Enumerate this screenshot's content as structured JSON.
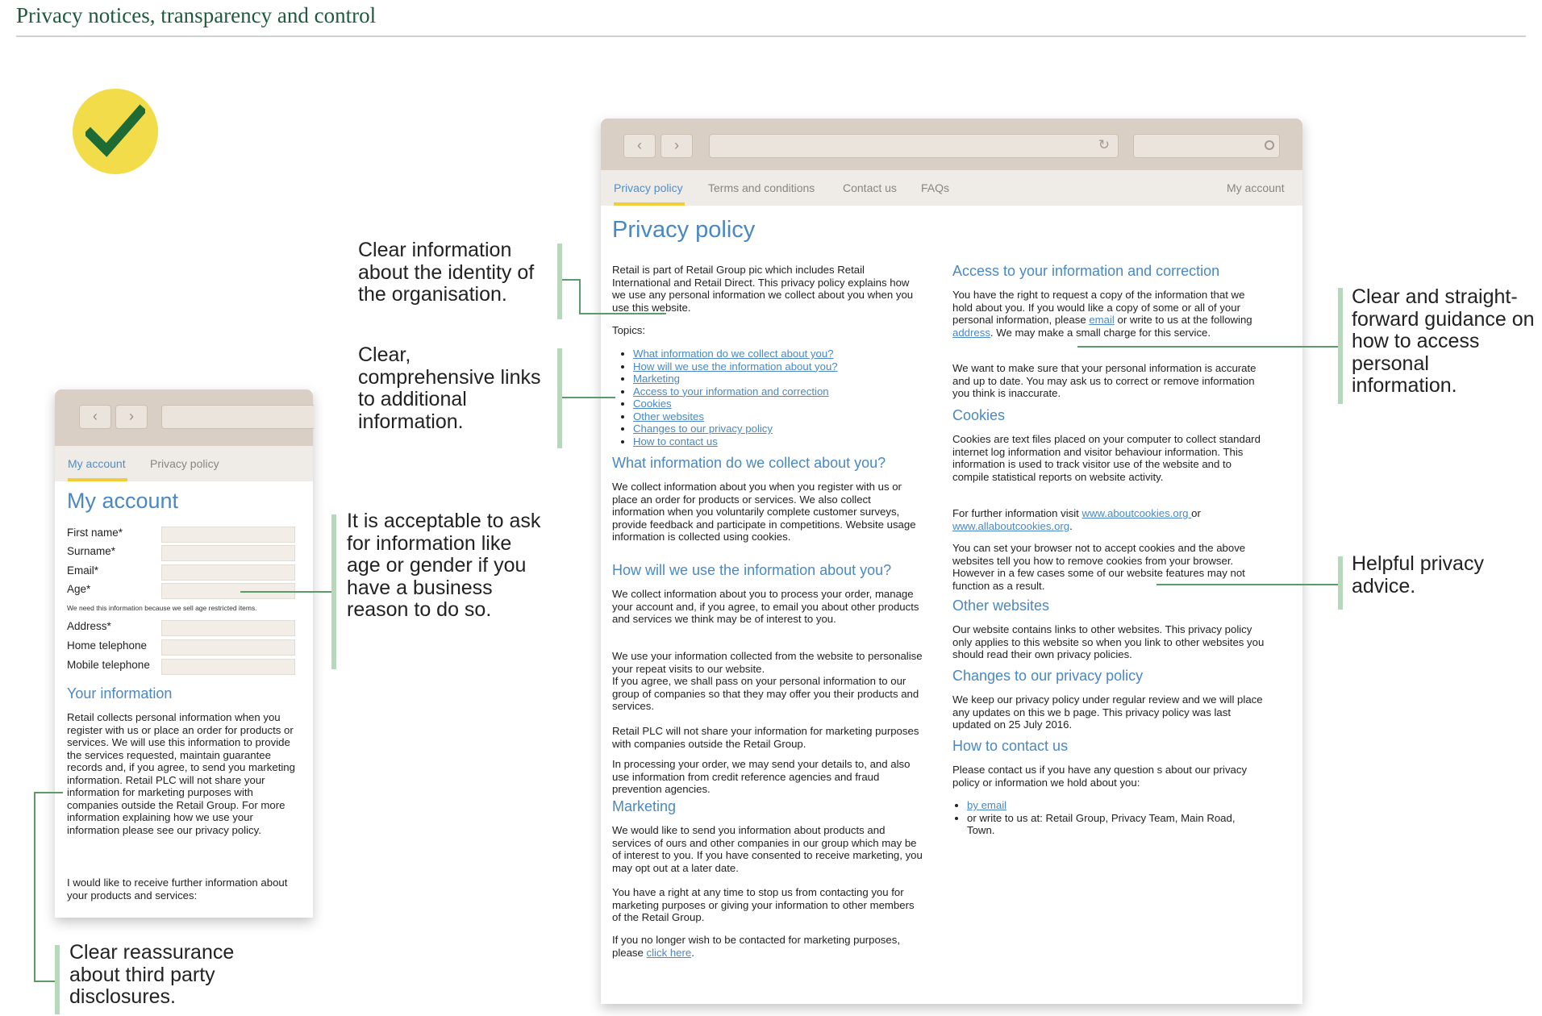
{
  "page_title": "Privacy notices, transparency and control",
  "icons": {
    "check": "checkmark-icon",
    "back": "chevron-left-icon",
    "forward": "chevron-right-icon",
    "reload": "reload-icon",
    "search": "search-icon"
  },
  "colors": {
    "accent_blue": "#4a88c4",
    "title_green": "#1f5a3f",
    "badge_yellow": "#f3dc4a",
    "check_green": "#1e6b34",
    "tab_underline": "#f1cd3a",
    "callout_bar": "#b6d9bc"
  },
  "mobile": {
    "tabs": {
      "active": "My account",
      "other": "Privacy policy"
    },
    "heading": "My account",
    "fields": {
      "first_name": "First name*",
      "surname": "Surname*",
      "email": "Email*",
      "age": "Age*",
      "address": "Address*",
      "home_telephone": "Home telephone",
      "mobile_telephone": "Mobile telephone"
    },
    "age_note": "We need this information because we sell age restricted items.",
    "your_info_heading": "Your information",
    "your_info_text": "Retail collects personal information when you register with us or place an order for products or services. We will use this information to provide the services requested, maintain guarantee records and, if you agree, to send you marketing information. Retail PLC will not share your information for marketing purposes with companies outside the Retail Group. For more information explaining how we use your information please see our privacy policy.",
    "further_info_text": "I would like to receive further information about your products and services:"
  },
  "desktop": {
    "tabs": {
      "privacy": "Privacy policy",
      "terms": "Terms and conditions",
      "contact": "Contact us",
      "faqs": "FAQs",
      "account": "My account"
    },
    "heading": "Privacy policy",
    "intro": "Retail is part of Retail Group pic which includes Retail International and Retail Direct. This privacy policy explains how we use any personal information we collect about you when you use this website.",
    "topics_label": "Topics:",
    "topics": {
      "t1": "What information do we collect about you?",
      "t2": "How will we use the information about you?",
      "t3": "Marketing",
      "t4": "Access to your information and correction",
      "t5": "Cookies",
      "t6": "Other websites",
      "t7": "Changes to our privacy policy",
      "t8": "How to contact us"
    },
    "collect": {
      "heading": "What information do we collect about you?",
      "text": "We collect information about you when you register with us or place an order for products or services. We also collect information when you voluntarily complete customer surveys, provide feedback and participate in competitions. Website usage information is collected using cookies."
    },
    "use": {
      "heading": "How will we use the information about you?",
      "p1": "We collect information about you to process your order, manage your account and, if you agree, to email you about other products and services we think may be of interest to you.",
      "p2a": "We use your information collected from the website to personalise your repeat visits to our website.",
      "p2b": "If you agree, we shall pass on your personal information to our group of companies so that they may offer you their products and services.",
      "p3": "Retail PLC will not share your information for marketing purposes with companies outside the Retail Group.",
      "p4": "In processing your order, we may send your details to, and also use information from credit reference agencies and fraud prevention agencies."
    },
    "marketing": {
      "heading": "Marketing",
      "p1": "We would like to send you information about products and services of ours and other companies in our group which may be of interest to you. If you have consented to receive marketing, you may opt out at a later date.",
      "p2": "You have a right at any time to stop us from contacting you for marketing purposes or giving your information to other members of the Retail Group.",
      "p3_pre": "If you no longer wish to be contacted for marketing purposes, please ",
      "p3_link": "click here",
      "p3_post": "."
    },
    "access": {
      "heading": "Access to your information and correction",
      "p1_a": "You have the right to request a copy of the information that we hold about you. If you would like a copy of some or all of your personal information, please ",
      "p1_link1": "email",
      "p1_b": " or write to us at the following ",
      "p1_link2": "address",
      "p1_c": ". We may make a small charge for this service.",
      "p2": "We want to make sure that your personal information is accurate and up to date. You may ask us to correct or remove information you think is inaccurate."
    },
    "cookies": {
      "heading": "Cookies",
      "p1": "Cookies are text files placed on your computer to collect standard internet log information and visitor behaviour information. This information is used to track visitor use of the website and to compile statistical reports on website activity.",
      "p2_pre": "For further information visit ",
      "p2_link1": "www.aboutcookies.org ",
      "p2_mid": "or ",
      "p2_link2": "www.allaboutcookies.org",
      "p2_post": ".",
      "p3": "You can set your browser not to accept cookies and the above websites tell you how to remove cookies from your browser. However in a few cases some of our website features may not function as a result."
    },
    "other": {
      "heading": "Other websites",
      "text": "Our website contains links to other websites. This privacy policy only applies to this website so when you link to other websites you should read their own privacy policies."
    },
    "changes": {
      "heading": "Changes to our privacy policy",
      "text": "We keep our privacy policy under regular review and we will place any updates on this we b page. This privacy policy was last updated on 25 July 2016."
    },
    "contact": {
      "heading": "How to contact us",
      "text": "Please contact us if you have any question s about our privacy policy or information we hold about you:",
      "item1": "by email",
      "item2": "or write to us at: Retail Group, Privacy Team, Main Road, Town."
    }
  },
  "callouts": {
    "identity": "Clear information about the identity of the organisation.",
    "links": "Clear, comprehensive links to additional information.",
    "age": "It is acceptable to ask for information like age or gender if you have a business reason to do so.",
    "third_party": "Clear reassurance about third party disclosures.",
    "access": "Clear and straight-forward guidance on how to access personal information.",
    "advice": "Helpful privacy advice."
  }
}
